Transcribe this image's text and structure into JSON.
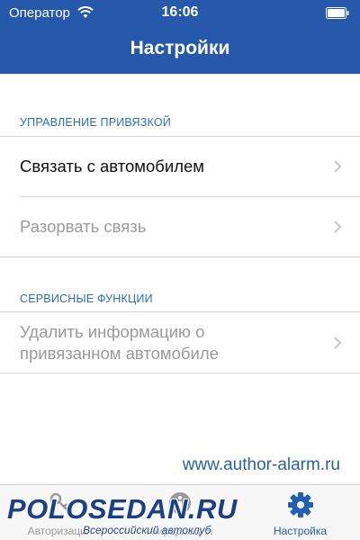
{
  "status_bar": {
    "carrier": "Оператор",
    "time": "16:06",
    "wifi_icon": "wifi-icon",
    "battery_icon": "battery-icon"
  },
  "nav": {
    "title": "Настройки"
  },
  "sections": [
    {
      "header": "УПРАВЛЕНИЕ ПРИВЯЗКОЙ",
      "items": [
        {
          "label": "Связать с автомобилем",
          "enabled": true
        },
        {
          "label": "Разорвать связь",
          "enabled": false
        }
      ]
    },
    {
      "header": "СЕРВИСНЫЕ ФУНКЦИИ",
      "items": [
        {
          "label_line1": "Удалить информацию о",
          "label_line2": "привязанном автомобиле",
          "enabled": false
        }
      ]
    }
  ],
  "website": "www.author-alarm.ru",
  "tabbar": {
    "tabs": [
      {
        "label": "Авторизация",
        "icon": "key-icon",
        "active": false
      },
      {
        "label": "Информация",
        "icon": "info-icon",
        "active": false
      },
      {
        "label": "Настройка",
        "icon": "gear-icon",
        "active": true
      }
    ]
  },
  "watermark": {
    "text": "POLOSEDAN.RU",
    "subtext": "Всероссийский автоклуб"
  },
  "colors": {
    "nav_bar": "#2659ab",
    "accent": "#1f5fb5",
    "section_header": "#2b6cb8",
    "disabled_text": "#9a9a9a"
  }
}
